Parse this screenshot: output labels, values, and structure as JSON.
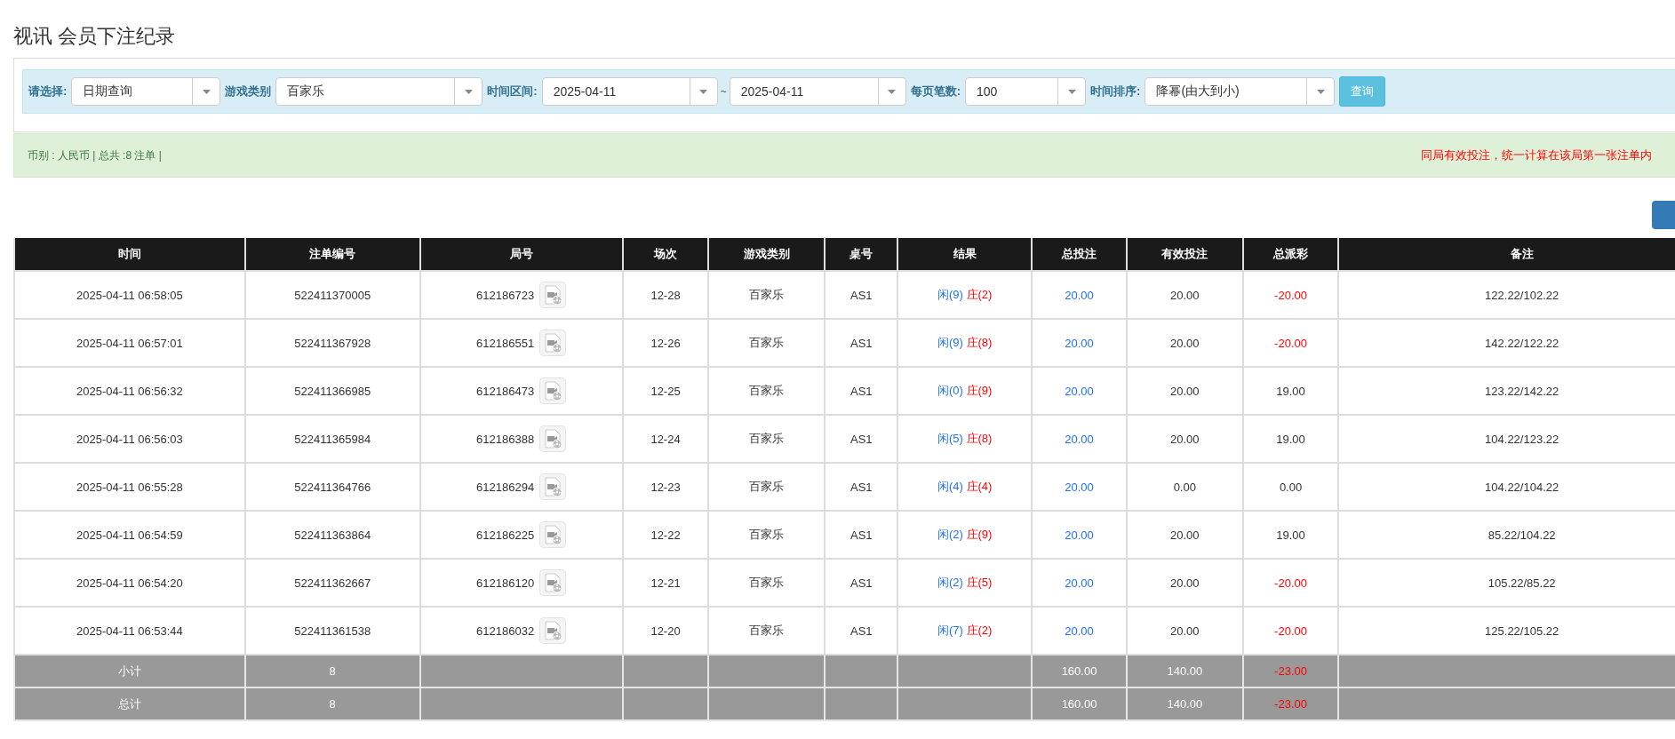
{
  "title": "视讯 会员下注纪录",
  "filters": [
    {
      "label": "请选择:",
      "value": "日期查询",
      "kind": "select"
    },
    {
      "label": "游戏类别",
      "value": "百家乐",
      "kind": "select"
    },
    {
      "label": "时间区间:",
      "from": "2025-04-11",
      "separator": "~",
      "to": "2025-04-11",
      "kind": "range"
    },
    {
      "label": "每页笔数:",
      "value": "100",
      "kind": "select"
    },
    {
      "label": "时间排序:",
      "value": "降幂(由大到小)",
      "kind": "select"
    }
  ],
  "search_button": "查询",
  "summary": "币别 : 人民币 | 总共 :8 注单 |",
  "notice": "同局有效投注，统一计算在该局第一张注单内",
  "table": {
    "columns": [
      "时间",
      "注单编号",
      "局号",
      "场次",
      "游戏类别",
      "桌号",
      "结果",
      "总投注",
      "有效投注",
      "总派彩",
      "备注"
    ],
    "rows": [
      {
        "time": "2025-04-11 06:58:05",
        "bet_no": "522411370005",
        "round": "612186723",
        "shoe": "12-28",
        "game": "百家乐",
        "table": "AS1",
        "player": "闲(9)",
        "banker": "庄(2)",
        "total_bet": "20.00",
        "valid_bet": "20.00",
        "payout": "-20.00",
        "loss": true,
        "note": "122.22/102.22"
      },
      {
        "time": "2025-04-11 06:57:01",
        "bet_no": "522411367928",
        "round": "612186551",
        "shoe": "12-26",
        "game": "百家乐",
        "table": "AS1",
        "player": "闲(9)",
        "banker": "庄(8)",
        "total_bet": "20.00",
        "valid_bet": "20.00",
        "payout": "-20.00",
        "loss": true,
        "note": "142.22/122.22"
      },
      {
        "time": "2025-04-11 06:56:32",
        "bet_no": "522411366985",
        "round": "612186473",
        "shoe": "12-25",
        "game": "百家乐",
        "table": "AS1",
        "player": "闲(0)",
        "banker": "庄(9)",
        "total_bet": "20.00",
        "valid_bet": "20.00",
        "payout": "19.00",
        "loss": false,
        "note": "123.22/142.22"
      },
      {
        "time": "2025-04-11 06:56:03",
        "bet_no": "522411365984",
        "round": "612186388",
        "shoe": "12-24",
        "game": "百家乐",
        "table": "AS1",
        "player": "闲(5)",
        "banker": "庄(8)",
        "total_bet": "20.00",
        "valid_bet": "20.00",
        "payout": "19.00",
        "loss": false,
        "note": "104.22/123.22"
      },
      {
        "time": "2025-04-11 06:55:28",
        "bet_no": "522411364766",
        "round": "612186294",
        "shoe": "12-23",
        "game": "百家乐",
        "table": "AS1",
        "player": "闲(4)",
        "banker": "庄(4)",
        "total_bet": "20.00",
        "valid_bet": "0.00",
        "payout": "0.00",
        "loss": false,
        "note": "104.22/104.22"
      },
      {
        "time": "2025-04-11 06:54:59",
        "bet_no": "522411363864",
        "round": "612186225",
        "shoe": "12-22",
        "game": "百家乐",
        "table": "AS1",
        "player": "闲(2)",
        "banker": "庄(9)",
        "total_bet": "20.00",
        "valid_bet": "20.00",
        "payout": "19.00",
        "loss": false,
        "note": "85.22/104.22"
      },
      {
        "time": "2025-04-11 06:54:20",
        "bet_no": "522411362667",
        "round": "612186120",
        "shoe": "12-21",
        "game": "百家乐",
        "table": "AS1",
        "player": "闲(2)",
        "banker": "庄(5)",
        "total_bet": "20.00",
        "valid_bet": "20.00",
        "payout": "-20.00",
        "loss": true,
        "note": "105.22/85.22"
      },
      {
        "time": "2025-04-11 06:53:44",
        "bet_no": "522411361538",
        "round": "612186032",
        "shoe": "12-20",
        "game": "百家乐",
        "table": "AS1",
        "player": "闲(7)",
        "banker": "庄(2)",
        "total_bet": "20.00",
        "valid_bet": "20.00",
        "payout": "-20.00",
        "loss": true,
        "note": "125.22/105.22"
      }
    ],
    "totals": [
      {
        "label": "小计",
        "count": "8",
        "total_bet": "160.00",
        "valid_bet": "140.00",
        "payout": "-23.00",
        "loss": true
      },
      {
        "label": "总计",
        "count": "8",
        "total_bet": "160.00",
        "valid_bet": "140.00",
        "payout": "-23.00",
        "loss": true
      }
    ]
  }
}
